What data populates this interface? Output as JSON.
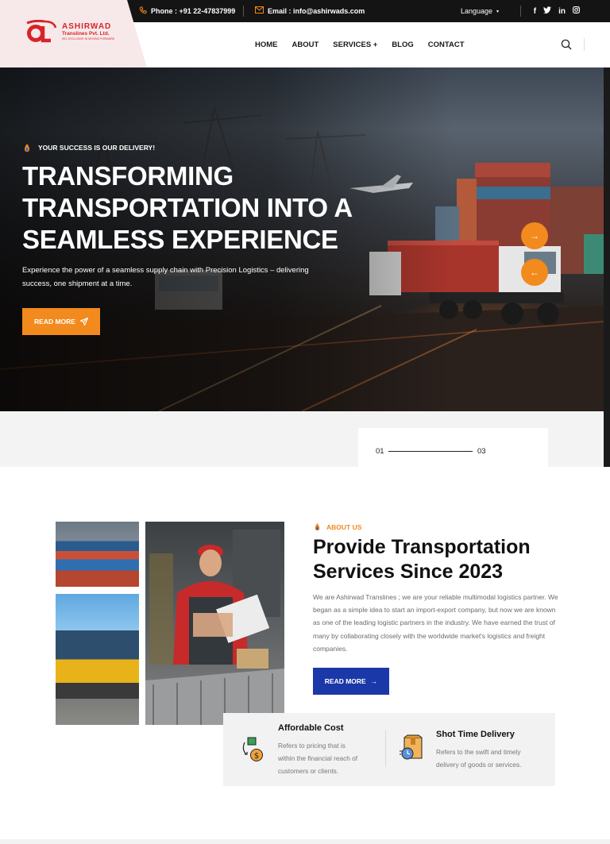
{
  "topbar": {
    "phone_label": "Phone : +91 22-47837999",
    "email_label": "Email : info@ashirwads.com",
    "language_label": "Language",
    "social": [
      "f",
      "t",
      "in",
      "ig"
    ]
  },
  "brand": {
    "name": "ASHIRWAD",
    "subtitle": "Translines Pvt. Ltd.",
    "tagline_small": "ISO, EXCLUSIVE IN MOVING FORWARD",
    "color": "#d6242a"
  },
  "nav": {
    "items": [
      "HOME",
      "ABOUT",
      "SERVICES +",
      "BLOG",
      "CONTACT"
    ]
  },
  "hero": {
    "tagline": "YOUR SUCCESS IS OUR DELIVERY!",
    "title_line1": "TRANSFORMING",
    "title_line2": "TRANSPORTATION INTO A",
    "title_line3": "SEAMLESS EXPERIENCE",
    "desc_line1": "Experience the power of a seamless supply chain with Precision Logistics – delivering",
    "desc_line2": "success, one shipment at a time.",
    "button": "READ MORE",
    "next_icon": "→",
    "prev_icon": "←"
  },
  "slider": {
    "current": "01",
    "total": "03"
  },
  "about": {
    "tag": "ABOUT US",
    "title_line1": "Provide Transportation",
    "title_line2": "Services Since 2023",
    "desc": "We are Ashirwad Translines ; we are your reliable multimodal logistics partner. We began as a simple idea to start an import-export company, but now we are known as one of the leading logistic partners in the industry. We have earned the trust of many by collaborating closely with the worldwide market's logistics and freight companies.",
    "button": "READ MORE"
  },
  "features": [
    {
      "title": "Affordable Cost",
      "desc_line1": "Refers to pricing that is",
      "desc_line2": "within the financial reach of",
      "desc_line3": "customers or clients."
    },
    {
      "title": "Shot Time Delivery",
      "desc_line1": "Refers to the swift and timely",
      "desc_line2": "delivery of goods or services."
    }
  ],
  "colors": {
    "accent": "#f28a1e",
    "primary_blue": "#1b38a8",
    "brand_red": "#d6242a"
  }
}
